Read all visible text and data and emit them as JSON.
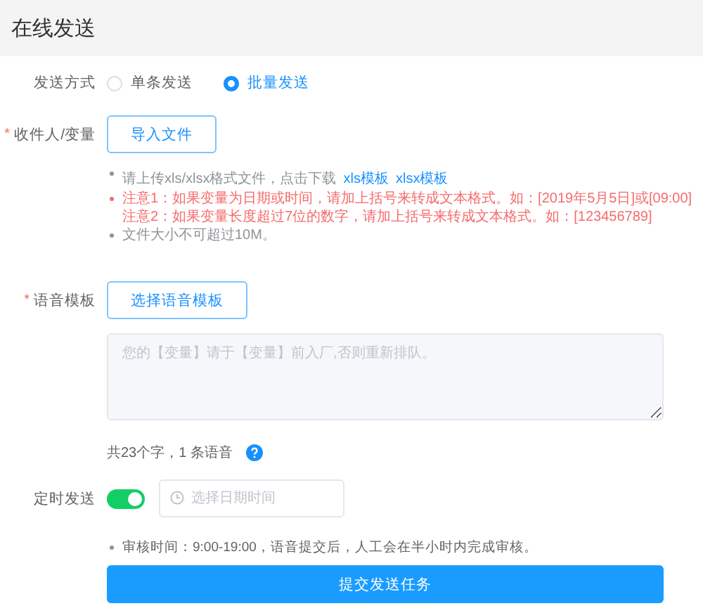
{
  "header": {
    "title": "在线发送"
  },
  "send_mode": {
    "label": "发送方式",
    "options": [
      {
        "label": "单条发送",
        "selected": false
      },
      {
        "label": "批量发送",
        "selected": true
      }
    ]
  },
  "recipients": {
    "label": "收件人/变量",
    "required_mark": "*",
    "button": "导入文件",
    "notes": [
      {
        "kind": "info",
        "lines": [
          "请上传xls/xlsx格式文件，点击下载"
        ],
        "links": [
          "xls模板",
          "xlsx模板"
        ]
      },
      {
        "kind": "warning",
        "lines": [
          "注意1：如果变量为日期或时间，请加上括号来转成文本格式。如：[2019年5月5日]或[09:00]",
          "注意2：如果变量长度超过7位的数字，请加上括号来转成文本格式。如：[123456789]"
        ]
      },
      {
        "kind": "info",
        "lines": [
          "文件大小不可超过10M。"
        ]
      }
    ]
  },
  "voice_template": {
    "label": "语音模板",
    "required_mark": "*",
    "button": "选择语音模板",
    "placeholder": "您的【变量】请于【变量】前入厂,否则重新排队。",
    "count": "共23个字，1 条语音"
  },
  "schedule": {
    "label": "定时发送",
    "on": true,
    "placeholder": "选择日期时间"
  },
  "review_note": "审核时间：9:00-19:00，语音提交后，人工会在半小时内完成审核。",
  "submit": "提交发送任务"
}
